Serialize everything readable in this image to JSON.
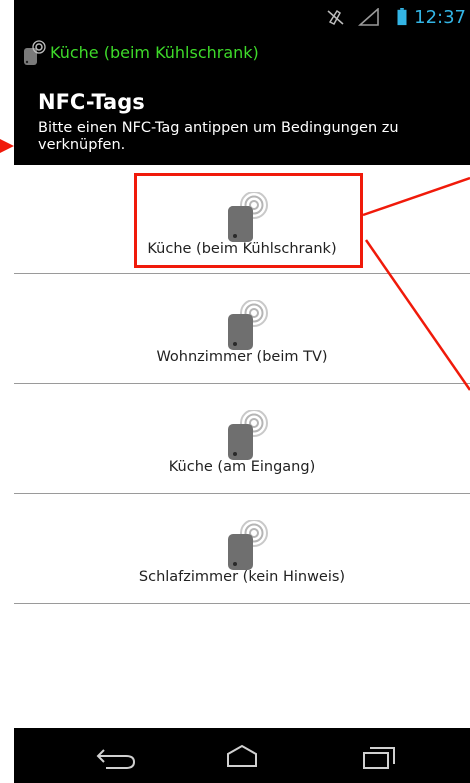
{
  "status_bar": {
    "time": "12:37",
    "icons": [
      "mute-icon",
      "signal-icon",
      "battery-icon"
    ]
  },
  "app_bar": {
    "title": "Küche (beim Kühlschrank)",
    "icon": "nfc-tag-icon",
    "title_color": "#3eda2a"
  },
  "header": {
    "title": "NFC-Tags",
    "description": "Bitte einen NFC-Tag antippen um Bedingungen zu verknüpfen."
  },
  "tags": [
    {
      "label": "Küche (beim Kühlschrank)"
    },
    {
      "label": "Wohnzimmer (beim TV)"
    },
    {
      "label": "Küche (am Eingang)"
    },
    {
      "label": "Schlafzimmer (kein Hinweis)"
    }
  ],
  "nav_bar": {
    "buttons": [
      "back-icon",
      "home-icon",
      "recent-apps-icon"
    ]
  },
  "colors": {
    "status_accent": "#33b5e5",
    "annotation": "#f01a0a",
    "background": "#000000"
  }
}
